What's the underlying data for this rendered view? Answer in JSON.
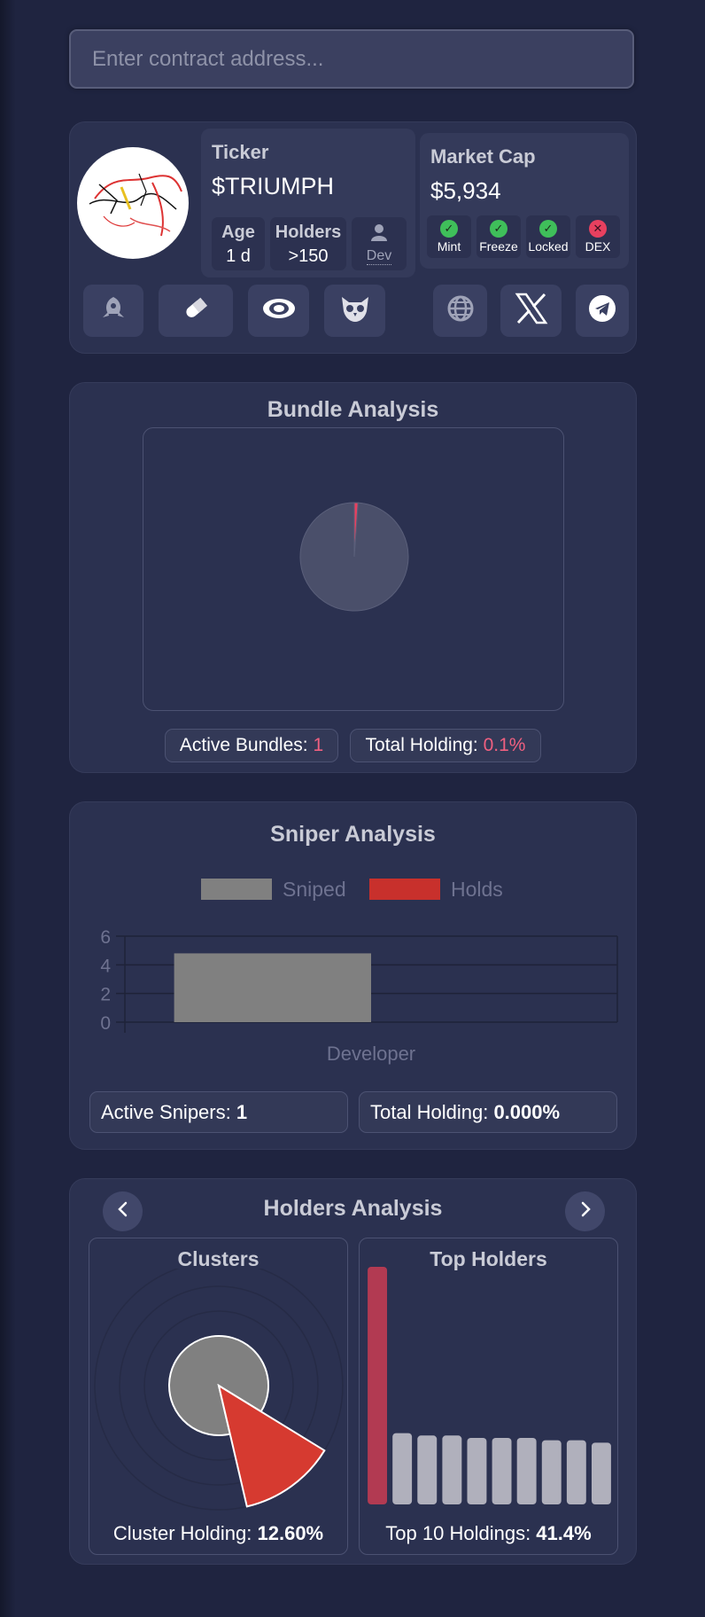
{
  "search": {
    "placeholder": "Enter contract address..."
  },
  "token": {
    "ticker_label": "Ticker",
    "ticker": "$TRIUMPH",
    "age_label": "Age",
    "age": "1 d",
    "holders_label": "Holders",
    "holders": ">150",
    "dev_label": "Dev",
    "market_cap_label": "Market Cap",
    "market_cap": "$5,934",
    "flags": [
      {
        "label": "Mint",
        "status": "ok",
        "color": "#3fbf5a"
      },
      {
        "label": "Freeze",
        "status": "ok",
        "color": "#3fbf5a"
      },
      {
        "label": "Locked",
        "status": "ok",
        "color": "#3fbf5a"
      },
      {
        "label": "DEX",
        "status": "fail",
        "color": "#e8405f"
      }
    ],
    "tool_icons": [
      "rocket-icon",
      "pill-icon",
      "eye-icon",
      "owl-icon"
    ],
    "social_icons": [
      "globe-icon",
      "x-logo-icon",
      "telegram-icon"
    ]
  },
  "bundle": {
    "title": "Bundle Analysis",
    "active_label": "Active Bundles: ",
    "active_value": "1",
    "holding_label": "Total Holding: ",
    "holding_value": "0.1%"
  },
  "sniper": {
    "title": "Sniper Analysis",
    "active_label": "Active Snipers: ",
    "active_value": "1",
    "holding_label": "Total Holding: ",
    "holding_value": "0.000%"
  },
  "holders": {
    "title": "Holders Analysis",
    "clusters_title": "Clusters",
    "cluster_label": "Cluster Holding: ",
    "cluster_value": "12.60%",
    "top_title": "Top Holders",
    "top_label": "Top 10 Holdings: ",
    "top_value": "41.4%"
  },
  "chart_data": [
    {
      "type": "pie",
      "title": "",
      "slices": [
        {
          "value": 0.1,
          "color": "#e8405f"
        },
        {
          "value": 99.9,
          "color": "#4a4f6a"
        }
      ]
    },
    {
      "type": "bar",
      "categories": [
        "Developer"
      ],
      "series": [
        {
          "name": "Sniped",
          "values": [
            4.8
          ],
          "color": "#808080"
        },
        {
          "name": "Holds",
          "values": [
            0
          ],
          "color": "#c8302c"
        }
      ],
      "xlabel": "",
      "ylabel": "",
      "ylim": [
        0,
        6
      ],
      "yticks": [
        0,
        2,
        4,
        6
      ],
      "legend": "top",
      "grid": true
    },
    {
      "type": "pie",
      "title": "",
      "slices": [
        {
          "value": 12.6,
          "color": "#d63a30"
        },
        {
          "value": 87.4,
          "color": "#808080"
        }
      ]
    },
    {
      "type": "bar",
      "title": "",
      "values": [
        100,
        30,
        29,
        29,
        28,
        28,
        28,
        27,
        27,
        26
      ],
      "colors": [
        "#b23a52",
        "#b0b0bc"
      ]
    }
  ]
}
